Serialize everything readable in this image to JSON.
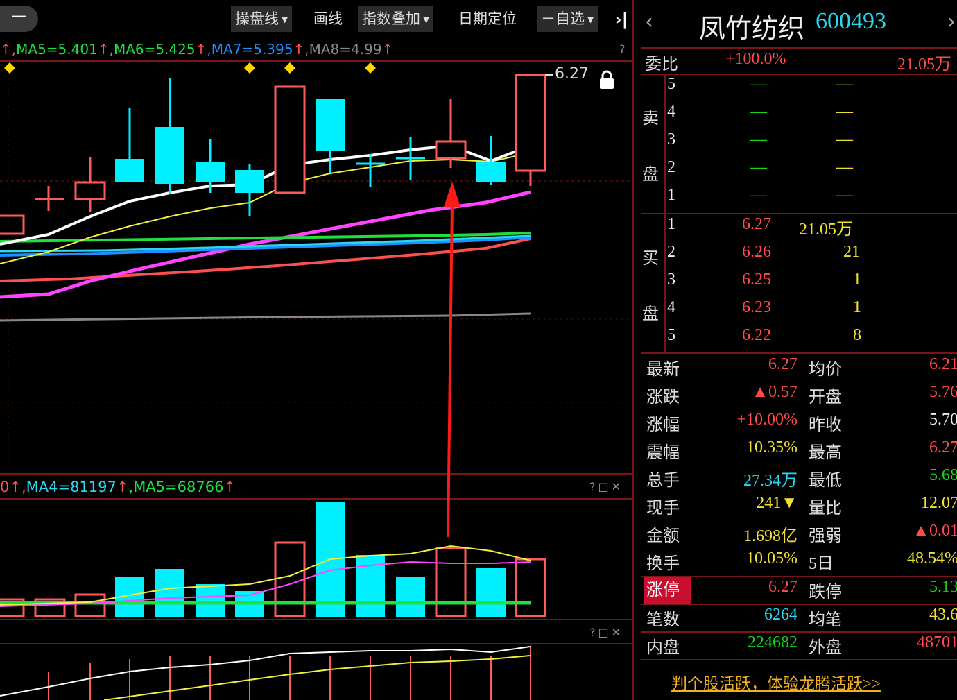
{
  "toolbar": {
    "minus": "－",
    "cao_pan_xian": "操盘线",
    "hua_xian": "画线",
    "index_overlay": "指数叠加",
    "date_locate": "日期定位",
    "watchlist": "自选",
    "watchlist_prefix": "－",
    "collapse": "›|"
  },
  "ma_legend": {
    "prefix": "↑,",
    "ma5": "MA5=5.401",
    "ma6": "MA6=5.425",
    "ma7": "MA7=5.395",
    "ma8": "MA8=4.99",
    "arrow": "↑",
    "help": "?"
  },
  "price_label": "6.27",
  "volume_legend": {
    "prefix": "0↑,",
    "ma4": "MA4=81197",
    "ma5": "MA5=68766",
    "arrow": "↑",
    "controls": "?□✕"
  },
  "indicator_controls": "?□✕",
  "colors": {
    "up": "#ff5a5a",
    "down": "#00f0ff",
    "ma_white": "#ffffff",
    "ma_yellow": "#f0f040",
    "ma_magenta": "#ff44ff",
    "ma_green": "#20e040",
    "ma_blue": "#1e90ff",
    "ma_red": "#ff5050",
    "ma_gray": "#888888",
    "arrow": "#ff1a1a"
  },
  "quote": {
    "back": "‹",
    "forward": "›",
    "name": "凤竹纺织",
    "code": "600493",
    "wei_bi_label": "委比",
    "wei_bi": "+100.0%",
    "wei_cha": "21.05万",
    "sell_label": [
      "卖",
      "盘"
    ],
    "buy_label": [
      "买",
      "盘"
    ],
    "sell": [
      {
        "level": "5",
        "price": "—",
        "vol": "—"
      },
      {
        "level": "4",
        "price": "—",
        "vol": "—"
      },
      {
        "level": "3",
        "price": "—",
        "vol": "—"
      },
      {
        "level": "2",
        "price": "—",
        "vol": "—"
      },
      {
        "level": "1",
        "price": "—",
        "vol": "—"
      }
    ],
    "buy": [
      {
        "level": "1",
        "price": "6.27",
        "vol": "21.05万"
      },
      {
        "level": "2",
        "price": "6.26",
        "vol": "21"
      },
      {
        "level": "3",
        "price": "6.25",
        "vol": "1"
      },
      {
        "level": "4",
        "price": "6.23",
        "vol": "1"
      },
      {
        "level": "5",
        "price": "6.22",
        "vol": "8"
      }
    ],
    "stats": [
      {
        "l1": "最新",
        "v1": "6.27",
        "l2": "均价",
        "v2": "6.21"
      },
      {
        "l1": "涨跌",
        "v1": "▲0.57",
        "l2": "开盘",
        "v2": "5.76"
      },
      {
        "l1": "涨幅",
        "v1": "+10.00%",
        "l2": "昨收",
        "v2": "5.70"
      },
      {
        "l1": "震幅",
        "v1": "10.35%",
        "l2": "最高",
        "v2": "6.27"
      },
      {
        "l1": "总手",
        "v1": "27.34万",
        "l2": "最低",
        "v2": "5.68"
      },
      {
        "l1": "现手",
        "v1": "241▼",
        "l2": "量比",
        "v2": "12.07"
      },
      {
        "l1": "金额",
        "v1": "1.698亿",
        "l2": "强弱",
        "v2": "▲0.01"
      },
      {
        "l1": "换手",
        "v1": "10.05%",
        "l2": "5日",
        "v2": "48.54%"
      },
      {
        "l1": "涨停",
        "v1": "6.27",
        "l2": "跌停",
        "v2": "5.13"
      },
      {
        "l1": "笔数",
        "v1": "6264",
        "l2": "均笔",
        "v2": "43.6"
      },
      {
        "l1": "内盘",
        "v1": "224682",
        "l2": "外盘",
        "v2": "48701"
      }
    ],
    "promo": "判个股活跃，体验龙腾活跃>>"
  }
}
